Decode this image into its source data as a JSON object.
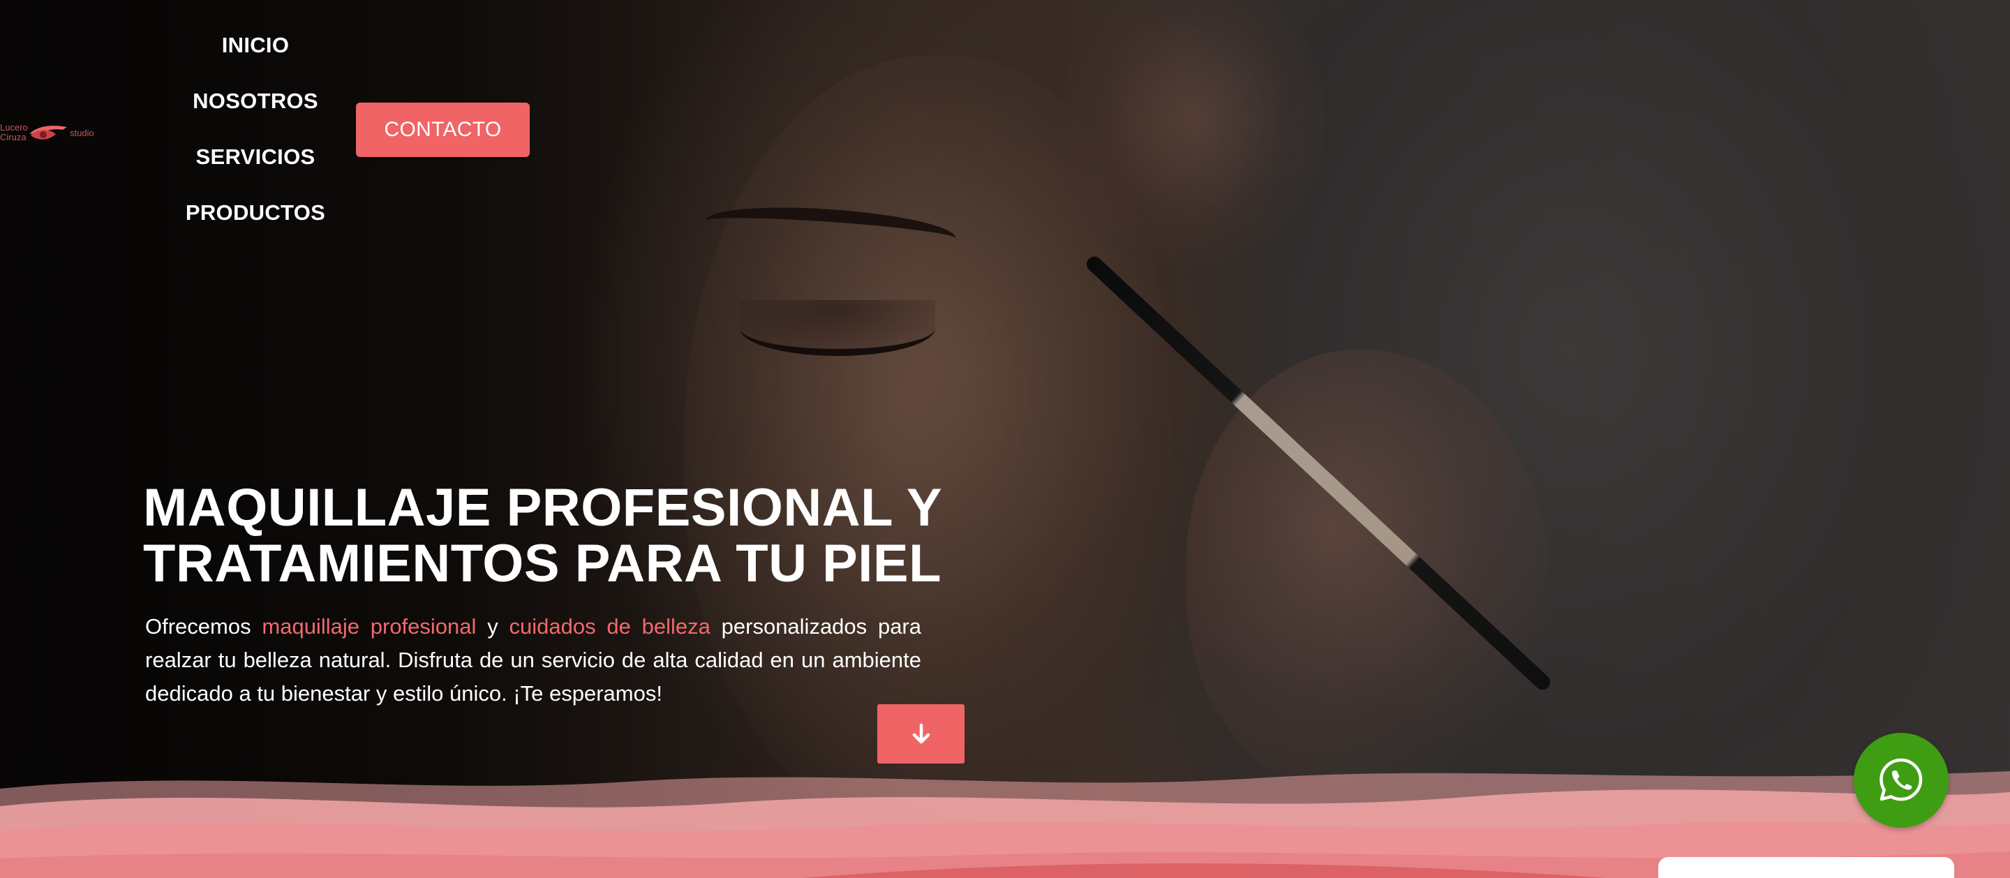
{
  "brand": {
    "logo_line1": "Lucero",
    "logo_line2": "Ciruza",
    "logo_studio": "studio",
    "logo_icon": "eye-brush-icon",
    "accent_color": "#f06466"
  },
  "nav": {
    "items": [
      {
        "label": "INICIO"
      },
      {
        "label": "NOSOTROS"
      },
      {
        "label": "SERVICIOS"
      },
      {
        "label": "PRODUCTOS"
      }
    ],
    "contact_label": "CONTACTO"
  },
  "hero": {
    "title_line1": "MAQUILLAJE PROFESIONAL Y",
    "title_line2": "TRATAMIENTOS PARA TU PIEL",
    "desc_part1": "Ofrecemos ",
    "desc_highlight1": "maquillaje profesional",
    "desc_part2": " y ",
    "desc_highlight2": "cuidados de belleza",
    "desc_part3": " personalizados para realzar tu belleza natural. Disfruta de un servicio de alta calidad en un ambiente dedicado a tu bienestar y estilo único. ¡Te esperamos!",
    "scroll_icon": "arrow-down-icon"
  },
  "floating": {
    "whatsapp_icon": "whatsapp-icon",
    "whatsapp_color": "#3f9d13"
  }
}
